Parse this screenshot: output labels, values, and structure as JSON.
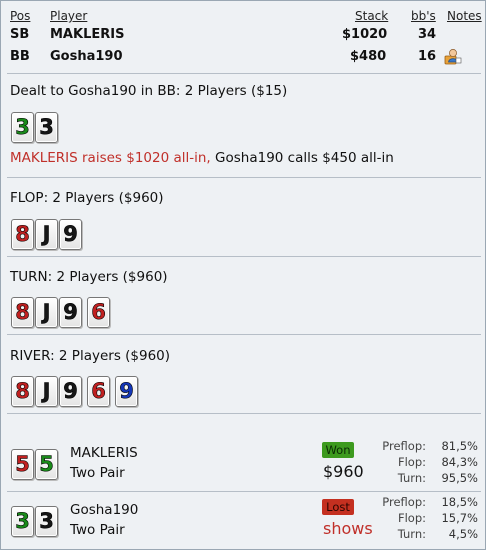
{
  "header": {
    "pos": "Pos",
    "player": "Player",
    "stack": "Stack",
    "bbs": "bb's",
    "notes": "Notes"
  },
  "players": [
    {
      "pos": "SB",
      "name": "MAKLERIS",
      "stack": "$1020",
      "bbs": "34"
    },
    {
      "pos": "BB",
      "name": "Gosha190",
      "stack": "$480",
      "bbs": "16",
      "notes_icon": "user-note-icon"
    }
  ],
  "preflop": {
    "title": "Dealt to Gosha190 in BB: 2 Players ($15)",
    "cards": [
      {
        "rank": "3",
        "suit": "club"
      },
      {
        "rank": "3",
        "suit": "spade"
      }
    ],
    "action_red": "MAKLERIS raises $1020 all-in,",
    "action_black": "Gosha190 calls $450 all-in"
  },
  "flop": {
    "title": "FLOP: 2 Players ($960)",
    "cards": [
      {
        "rank": "8",
        "suit": "heart"
      },
      {
        "rank": "J",
        "suit": "spade"
      },
      {
        "rank": "9",
        "suit": "spade"
      }
    ]
  },
  "turn": {
    "title": "TURN: 2 Players ($960)",
    "cards": [
      {
        "rank": "8",
        "suit": "heart"
      },
      {
        "rank": "J",
        "suit": "spade"
      },
      {
        "rank": "9",
        "suit": "spade"
      },
      {
        "rank": "6",
        "suit": "heart"
      }
    ]
  },
  "river": {
    "title": "RIVER: 2 Players ($960)",
    "cards": [
      {
        "rank": "8",
        "suit": "heart"
      },
      {
        "rank": "J",
        "suit": "spade"
      },
      {
        "rank": "9",
        "suit": "spade"
      },
      {
        "rank": "6",
        "suit": "heart"
      },
      {
        "rank": "9",
        "suit": "diamond"
      }
    ]
  },
  "results": [
    {
      "name": "MAKLERIS",
      "hand": "Two Pair",
      "badge": "Won",
      "amount": "$960",
      "cards": [
        {
          "rank": "5",
          "suit": "heart"
        },
        {
          "rank": "5",
          "suit": "club"
        }
      ],
      "stats": [
        {
          "k": "Preflop:",
          "v": "81,5%"
        },
        {
          "k": "Flop:",
          "v": "84,3%"
        },
        {
          "k": "Turn:",
          "v": "95,5%"
        }
      ]
    },
    {
      "name": "Gosha190",
      "hand": "Two Pair",
      "badge": "Lost",
      "amount": "shows",
      "cards": [
        {
          "rank": "3",
          "suit": "club"
        },
        {
          "rank": "3",
          "suit": "spade"
        }
      ],
      "stats": [
        {
          "k": "Preflop:",
          "v": "18,5%"
        },
        {
          "k": "Flop:",
          "v": "15,7%"
        },
        {
          "k": "Turn:",
          "v": "4,5%"
        }
      ]
    }
  ],
  "colors": {
    "heart": "#c02020",
    "club": "#1a8a1a",
    "spade": "#161616",
    "diamond": "#1436b8",
    "won": "#3d9a1e",
    "lost": "#c43020"
  }
}
